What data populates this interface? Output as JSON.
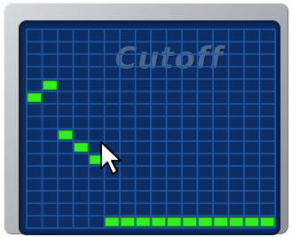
{
  "panel": {
    "title": "Cutoff",
    "colors": {
      "background": "#0c2e64",
      "grid": "#1f5aa6",
      "step": "#34f01c"
    }
  },
  "sequencer": {
    "columns": 16,
    "rows": 16,
    "steps": [
      {
        "step": 1,
        "level": 10
      },
      {
        "step": 2,
        "level": 11
      },
      {
        "step": 3,
        "level": 7
      },
      {
        "step": 4,
        "level": 6
      },
      {
        "step": 5,
        "level": 5
      },
      {
        "step": 6,
        "level": 0
      },
      {
        "step": 7,
        "level": 0
      },
      {
        "step": 8,
        "level": 0
      },
      {
        "step": 9,
        "level": 0
      },
      {
        "step": 10,
        "level": 0
      },
      {
        "step": 11,
        "level": 0
      },
      {
        "step": 12,
        "level": 0
      },
      {
        "step": 13,
        "level": 0
      },
      {
        "step": 14,
        "level": 0
      },
      {
        "step": 15,
        "level": 0
      },
      {
        "step": 16,
        "level": 0
      }
    ]
  },
  "cursor": {
    "icon": "arrow-cursor-icon"
  }
}
